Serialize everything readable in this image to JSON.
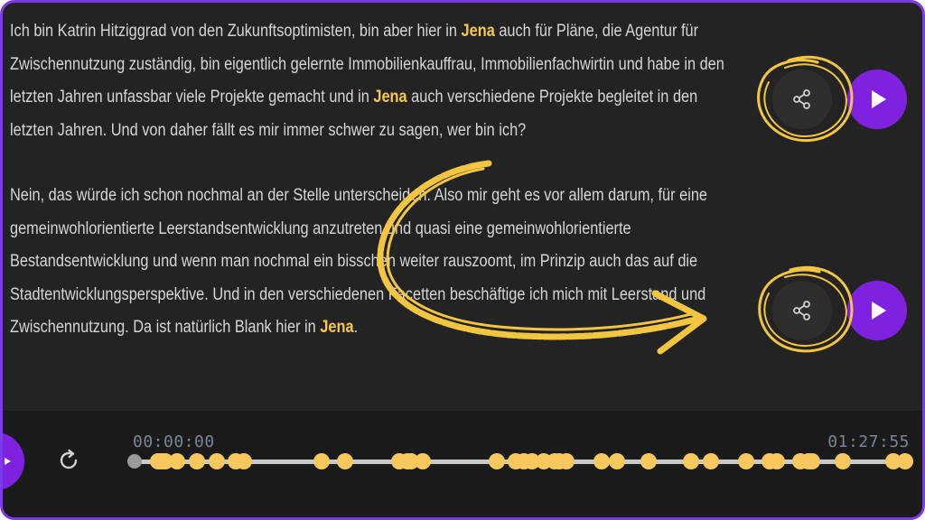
{
  "transcript": {
    "paragraphs": [
      [
        {
          "t": "Ich bin Katrin Hitziggrad von den Zukunftsoptimisten, bin aber hier in "
        },
        {
          "t": "Jena",
          "hl": true
        },
        {
          "t": " auch für Pläne, die Agentur für Zwischennutzung zuständig, bin eigentlich gelernte Immobilienkauffrau, Immobilienfachwirtin und habe in den letzten Jahren unfassbar viele Projekte gemacht und in "
        },
        {
          "t": "Jena",
          "hl": true
        },
        {
          "t": " auch verschiedene Projekte begleitet in den letzten Jahren. Und von daher fällt es mir immer schwer zu sagen, wer bin ich?"
        }
      ],
      [
        {
          "t": "Nein, das würde ich schon nochmal an der Stelle unterscheiden. Also mir geht es vor allem darum, für eine gemeinwohlorientierte Leerstandsentwicklung anzutreten und quasi eine gemeinwohlorientierte Bestandsentwicklung und wenn man nochmal ein bisschen weiter rauszoomt, im Prinzip auch das auf die Stadtentwicklungsperspektive. Und in den verschiedenen Facetten beschäftige ich mich mit Leerstand und Zwischennutzung. Da ist natürlich Blank hier in "
        },
        {
          "t": "Jena",
          "hl": true
        },
        {
          "t": "."
        }
      ]
    ]
  },
  "icons": {
    "share": "share-icon",
    "play": "play-icon",
    "reload": "reload-icon"
  },
  "player": {
    "time_start": "00:00:00",
    "time_end": "01:27:55",
    "duration_seconds": 5275,
    "progress_fraction": 0,
    "marker_positions": [
      0.03,
      0.035,
      0.04,
      0.055,
      0.08,
      0.105,
      0.13,
      0.14,
      0.24,
      0.27,
      0.34,
      0.35,
      0.355,
      0.37,
      0.465,
      0.49,
      0.5,
      0.51,
      0.525,
      0.54,
      0.545,
      0.555,
      0.6,
      0.62,
      0.66,
      0.715,
      0.74,
      0.785,
      0.815,
      0.825,
      0.855,
      0.865,
      0.87,
      0.91,
      0.975,
      0.99
    ]
  },
  "colors": {
    "accent": "#7e22e0",
    "highlight": "#f5c84c",
    "marker": "#f7c85e",
    "background": "#232323",
    "annotation": "#f2c640"
  }
}
